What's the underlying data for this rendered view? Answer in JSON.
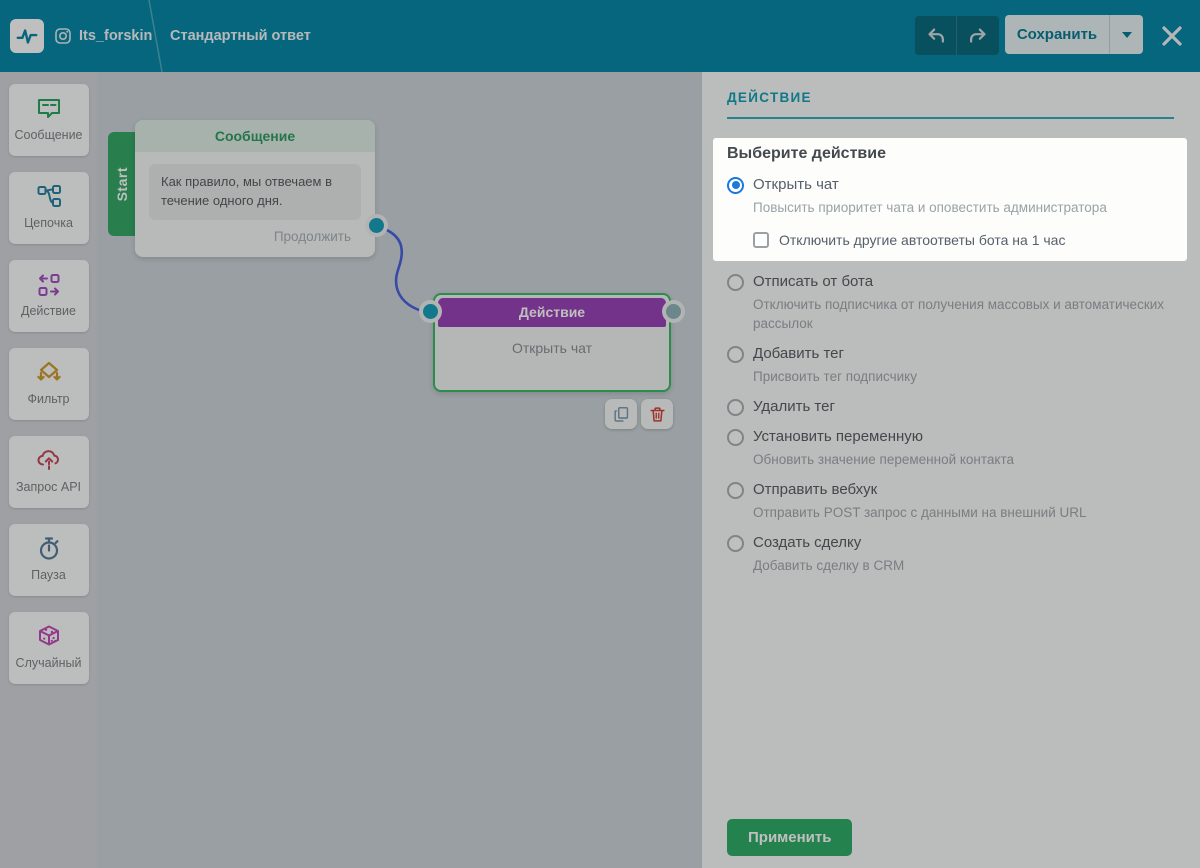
{
  "header": {
    "account_name": "Its_forskin",
    "flow_title": "Стандартный ответ",
    "save_label": "Сохранить"
  },
  "sidebar": {
    "items": [
      {
        "label": "Сообщение",
        "icon": "message-icon"
      },
      {
        "label": "Цепочка",
        "icon": "chain-icon"
      },
      {
        "label": "Действие",
        "icon": "action-icon"
      },
      {
        "label": "Фильтр",
        "icon": "filter-icon"
      },
      {
        "label": "Запрос API",
        "icon": "api-icon"
      },
      {
        "label": "Пауза",
        "icon": "pause-icon"
      },
      {
        "label": "Случайный",
        "icon": "random-icon"
      }
    ]
  },
  "canvas": {
    "start_tab": "Start",
    "message_node": {
      "title": "Сообщение",
      "text": "Как правило, мы отвечаем в течение одного дня.",
      "continue_label": "Продолжить"
    },
    "action_node": {
      "title": "Действие",
      "text": "Открыть чат"
    }
  },
  "panel": {
    "title": "ДЕЙСТВИЕ",
    "section_heading": "Выберите действие",
    "apply_label": "Применить",
    "options": [
      {
        "label": "Открыть чат",
        "description": "Повысить приоритет чата и оповестить администратора",
        "selected": true,
        "checkbox_label": "Отключить другие автоответы бота на 1 час",
        "checkbox_checked": false
      },
      {
        "label": "Отписать от бота",
        "description": "Отключить подписчика от получения массовых и автоматических рассылок",
        "selected": false
      },
      {
        "label": "Добавить тег",
        "description": "Присвоить тег подписчику",
        "selected": false
      },
      {
        "label": "Удалить тег",
        "description": "",
        "selected": false
      },
      {
        "label": "Установить переменную",
        "description": "Обновить значение переменной контакта",
        "selected": false
      },
      {
        "label": "Отправить вебхук",
        "description": "Отправить POST запрос с данными на внешний URL",
        "selected": false
      },
      {
        "label": "Создать сделку",
        "description": "Добавить сделку в CRM",
        "selected": false
      }
    ]
  },
  "colors": {
    "header_teal": "#0789a7",
    "panel_accent_teal": "#17a0b8",
    "start_green": "#36a967",
    "message_green": "#2f9e60",
    "action_purple": "#9b44b8",
    "selection_green": "#3bbd63",
    "edge_blue": "#4a63e0",
    "radio_blue": "#1b78dc",
    "apply_green": "#2fae68",
    "delete_red": "#d64031",
    "dim_overlay": "rgba(0,0,0,0.25)"
  }
}
